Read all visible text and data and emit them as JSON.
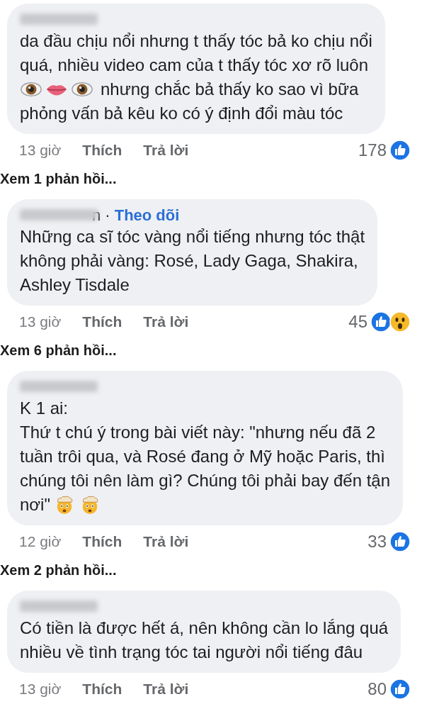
{
  "comments": [
    {
      "lines": [
        [
          {
            "kind": "text",
            "text": "da đầu chịu nổi nhưng t thấy tóc bả ko chịu nổi"
          }
        ],
        [
          {
            "kind": "text",
            "text": "quá, nhiều video cam của t thấy tóc xơ rõ luôn"
          }
        ],
        [
          {
            "kind": "eye"
          },
          {
            "kind": "lips"
          },
          {
            "kind": "eye"
          },
          {
            "kind": "text",
            "text": "nhưng chắc bả thấy ko sao vì bữa"
          }
        ],
        [
          {
            "kind": "text",
            "text": "phỏng vấn bả kêu ko có ý định đổi màu tóc"
          }
        ]
      ],
      "time": "13 giờ",
      "like": "Thích",
      "reply": "Trả lời",
      "count": "178",
      "reactions": [
        {
          "kind": "like"
        }
      ],
      "replies": "Xem 1 phản hồi..."
    },
    {
      "author_line": {
        "follow": "Theo dõi",
        "separator": "n ·"
      },
      "lines": [
        [
          {
            "kind": "text",
            "text": "Những ca sĩ tóc vàng nổi tiếng nhưng tóc thật"
          }
        ],
        [
          {
            "kind": "text",
            "text": "không phải vàng: Rosé, Lady Gaga, Shakira,"
          }
        ],
        [
          {
            "kind": "text",
            "text": "Ashley Tisdale"
          }
        ]
      ],
      "time": "13 giờ",
      "like": "Thích",
      "reply": "Trả lời",
      "count": "45",
      "reactions": [
        {
          "kind": "like"
        },
        {
          "kind": "wow"
        }
      ],
      "replies": "Xem 6 phản hồi..."
    },
    {
      "lines": [
        [
          {
            "kind": "text",
            "text": "K 1 ai:"
          }
        ],
        [
          {
            "kind": "text",
            "text": "Thứ t chú ý trong bài viết này: \"nhưng nếu đã 2"
          }
        ],
        [
          {
            "kind": "text",
            "text": "tuần trôi qua, và Rosé đang ở Mỹ hoặc Paris, thì"
          }
        ],
        [
          {
            "kind": "text",
            "text": "chúng tôi nên làm gì? Chúng tôi phải bay đến tận"
          }
        ],
        [
          {
            "kind": "text",
            "text": "nơi\""
          },
          {
            "kind": "mind-blown"
          },
          {
            "kind": "mind-blown"
          }
        ]
      ],
      "time": "12 giờ",
      "like": "Thích",
      "reply": "Trả lời",
      "count": "33",
      "reactions": [
        {
          "kind": "like"
        }
      ],
      "replies": "Xem 2 phản hồi..."
    },
    {
      "lines": [
        [
          {
            "kind": "text",
            "text": "Có tiền là được hết á, nên không cần lo lắng quá"
          }
        ],
        [
          {
            "kind": "text",
            "text": "nhiều về tình trạng tóc tai người nổi tiếng đâu"
          }
        ]
      ],
      "time": "13 giờ",
      "like": "Thích",
      "reply": "Trả lời",
      "count": "80",
      "reactions": [
        {
          "kind": "like"
        }
      ]
    }
  ]
}
